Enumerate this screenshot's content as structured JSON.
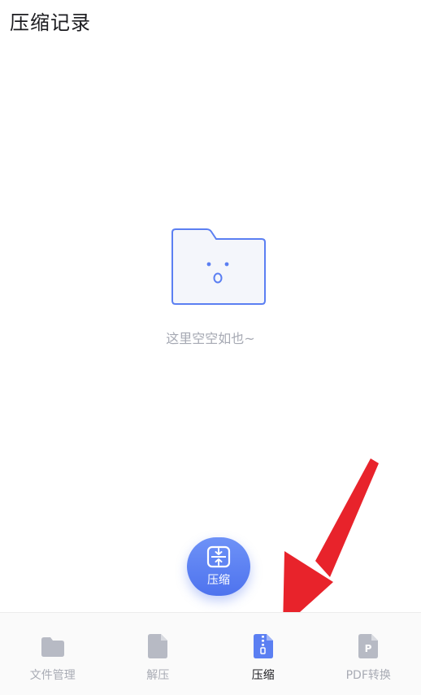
{
  "header": {
    "title": "压缩记录"
  },
  "empty_state": {
    "message": "这里空空如也~"
  },
  "fab": {
    "label": "压缩",
    "icon": "compress-icon"
  },
  "tabbar": {
    "items": [
      {
        "label": "文件管理",
        "icon": "folder-icon",
        "active": false
      },
      {
        "label": "解压",
        "icon": "file-icon",
        "active": false
      },
      {
        "label": "压缩",
        "icon": "zip-file-icon",
        "active": true
      },
      {
        "label": "PDF转换",
        "icon": "pdf-file-icon",
        "active": false
      }
    ]
  },
  "colors": {
    "accent": "#5b7ff2",
    "inactive_icon": "#b7bac4",
    "arrow": "#e8232b"
  }
}
